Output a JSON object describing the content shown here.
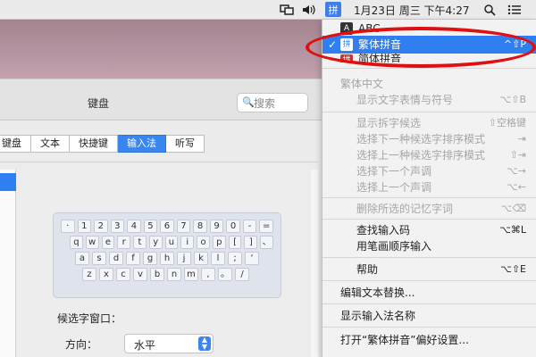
{
  "menubar": {
    "ime_glyph": "拼",
    "clock": "1月23日 周三 下午4:27",
    "icons": [
      "display-icon",
      "volume-icon",
      "input-method-icon",
      "search-icon",
      "list-icon"
    ]
  },
  "window": {
    "title": "键盘",
    "search_placeholder": "搜索",
    "tabs": [
      {
        "label": "键盘"
      },
      {
        "label": "文本"
      },
      {
        "label": "快捷键"
      },
      {
        "label": "输入法",
        "active": true
      },
      {
        "label": "听写"
      }
    ]
  },
  "keyboard": {
    "rows": [
      [
        "·",
        "1",
        "2",
        "3",
        "4",
        "5",
        "6",
        "7",
        "8",
        "9",
        "0",
        "-",
        "="
      ],
      [
        "q",
        "w",
        "e",
        "r",
        "t",
        "y",
        "u",
        "i",
        "o",
        "p",
        "[",
        "]",
        "、"
      ],
      [
        "a",
        "s",
        "d",
        "f",
        "g",
        "h",
        "j",
        "k",
        "l",
        ";",
        "‘"
      ],
      [
        "z",
        "x",
        "c",
        "v",
        "b",
        "n",
        "m",
        ",",
        "。",
        "/"
      ]
    ]
  },
  "settings": {
    "candidate_window_label": "候选字窗口：",
    "direction_label": "方向：",
    "direction_value": "水平"
  },
  "menu": {
    "item_abc": "ABC",
    "item_traditional": "繁体拼音",
    "item_traditional_shortcut": "^⇧P",
    "item_simplified_partial": "简体拼音",
    "section_traditional": "繁体中文",
    "show_emoji": "显示文字表情与符号",
    "show_emoji_sc": "⌥⇧B",
    "show_split": "显示拆字候选",
    "show_split_sc": "⇧空格键",
    "next_sort": "选择下一种候选字排序模式",
    "next_sort_sc": "⇥",
    "prev_sort": "选择上一种候选字排序模式",
    "prev_sort_sc": "⇧⇥",
    "next_tone": "选择下一个声调",
    "next_tone_sc": "⌥→",
    "prev_tone": "选择上一个声调",
    "prev_tone_sc": "⌥←",
    "delete_memory": "删除所选的记忆字词",
    "delete_memory_sc": "⌥⌫",
    "find_code": "查找输入码",
    "find_code_sc": "⌥⌘L",
    "stroke_input": "用笔画顺序输入",
    "help": "帮助",
    "help_sc": "⌥⇧E",
    "edit_replace": "编辑文本替换...",
    "show_name": "显示输入法名称",
    "open_prefs": "打开“繁体拼音”偏好设置..."
  }
}
